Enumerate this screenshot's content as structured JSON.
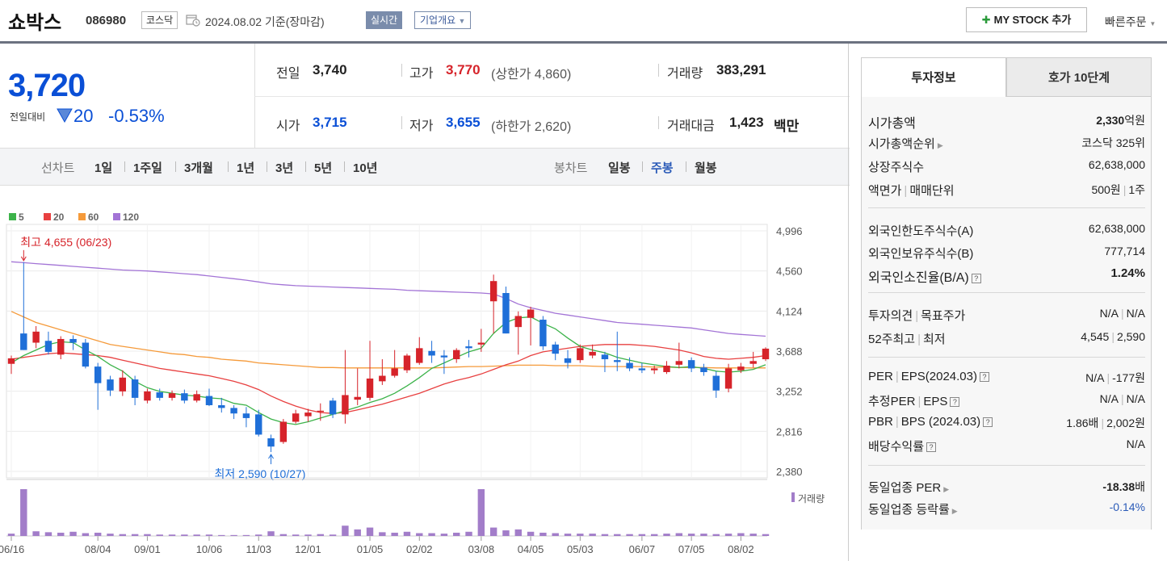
{
  "header": {
    "stock_name": "쇼박스",
    "stock_code": "086980",
    "market": "코스닥",
    "base_date": "2024.08.02 기준(장마감)",
    "realtime_label": "실시간",
    "overview_label": "기업개요",
    "mystock_label": "MY STOCK 추가",
    "quick_order_label": "빠른주문"
  },
  "price": {
    "current": "3,720",
    "prev_compare_label": "전일대비",
    "change": "20",
    "change_pct": "-0.53%",
    "prev_close_label": "전일",
    "prev_close": "3,740",
    "high_label": "고가",
    "high": "3,770",
    "upper_limit": "(상한가 4,860)",
    "volume_label": "거래량",
    "volume": "383,291",
    "open_label": "시가",
    "open": "3,715",
    "low_label": "저가",
    "low": "3,655",
    "lower_limit": "(하한가 2,620)",
    "amount_label": "거래대금",
    "amount": "1,423",
    "amount_unit": "백만"
  },
  "period_bar": {
    "line_chart_label": "선차트",
    "line_periods": [
      "1일",
      "1주일",
      "3개월",
      "1년",
      "3년",
      "5년",
      "10년"
    ],
    "candle_chart_label": "봉차트",
    "candle_periods": [
      "일봉",
      "주봉",
      "월봉"
    ],
    "candle_selected": "주봉"
  },
  "chart_data": {
    "type": "candlestick",
    "legend": [
      {
        "name": "5",
        "color": "#3cb34a"
      },
      {
        "name": "20",
        "color": "#e84040"
      },
      {
        "name": "60",
        "color": "#f59a3a"
      },
      {
        "name": "120",
        "color": "#a374d6"
      }
    ],
    "y_ticks": [
      "4,996",
      "4,560",
      "4,124",
      "3,688",
      "3,252",
      "2,816",
      "2,380"
    ],
    "ylim": [
      2380,
      4996
    ],
    "x_ticks": [
      "06/16",
      "08/04",
      "09/01",
      "10/06",
      "11/03",
      "12/01",
      "01/05",
      "02/02",
      "03/08",
      "04/05",
      "05/03",
      "06/07",
      "07/05",
      "08/02"
    ],
    "x_tick_index": [
      0,
      7,
      11,
      16,
      20,
      24,
      29,
      33,
      38,
      42,
      46,
      51,
      55,
      59
    ],
    "high_annotation": "최고 4,655 (06/23)",
    "low_annotation": "최저 2,590 (10/27)",
    "volume_label": "거래량",
    "candles": [
      {
        "o": 3550,
        "h": 3640,
        "l": 3440,
        "c": 3610
      },
      {
        "o": 3880,
        "h": 4655,
        "l": 3700,
        "c": 3700
      },
      {
        "o": 3780,
        "h": 3960,
        "l": 3720,
        "c": 3900
      },
      {
        "o": 3800,
        "h": 3900,
        "l": 3650,
        "c": 3680
      },
      {
        "o": 3650,
        "h": 3850,
        "l": 3600,
        "c": 3820
      },
      {
        "o": 3820,
        "h": 3860,
        "l": 3700,
        "c": 3780
      },
      {
        "o": 3780,
        "h": 3820,
        "l": 3500,
        "c": 3520
      },
      {
        "o": 3520,
        "h": 3560,
        "l": 3050,
        "c": 3340
      },
      {
        "o": 3380,
        "h": 3420,
        "l": 3200,
        "c": 3260
      },
      {
        "o": 3250,
        "h": 3480,
        "l": 3200,
        "c": 3400
      },
      {
        "o": 3380,
        "h": 3420,
        "l": 3100,
        "c": 3180
      },
      {
        "o": 3150,
        "h": 3280,
        "l": 3120,
        "c": 3250
      },
      {
        "o": 3240,
        "h": 3280,
        "l": 3150,
        "c": 3180
      },
      {
        "o": 3180,
        "h": 3260,
        "l": 3150,
        "c": 3230
      },
      {
        "o": 3230,
        "h": 3270,
        "l": 3120,
        "c": 3150
      },
      {
        "o": 3150,
        "h": 3260,
        "l": 3130,
        "c": 3220
      },
      {
        "o": 3200,
        "h": 3280,
        "l": 3090,
        "c": 3100
      },
      {
        "o": 3100,
        "h": 3180,
        "l": 3020,
        "c": 3070
      },
      {
        "o": 3070,
        "h": 3100,
        "l": 2950,
        "c": 3010
      },
      {
        "o": 3010,
        "h": 3080,
        "l": 2860,
        "c": 2960
      },
      {
        "o": 3000,
        "h": 3050,
        "l": 2760,
        "c": 2780
      },
      {
        "o": 2740,
        "h": 2780,
        "l": 2590,
        "c": 2650
      },
      {
        "o": 2700,
        "h": 2950,
        "l": 2680,
        "c": 2920
      },
      {
        "o": 2920,
        "h": 3050,
        "l": 2900,
        "c": 3010
      },
      {
        "o": 2980,
        "h": 3060,
        "l": 2920,
        "c": 3020
      },
      {
        "o": 3030,
        "h": 3120,
        "l": 2930,
        "c": 3040
      },
      {
        "o": 3150,
        "h": 3180,
        "l": 2960,
        "c": 3000
      },
      {
        "o": 3000,
        "h": 3700,
        "l": 2900,
        "c": 3210
      },
      {
        "o": 3160,
        "h": 3500,
        "l": 3100,
        "c": 3190
      },
      {
        "o": 3180,
        "h": 3800,
        "l": 3150,
        "c": 3390
      },
      {
        "o": 3360,
        "h": 3600,
        "l": 3320,
        "c": 3420
      },
      {
        "o": 3420,
        "h": 3700,
        "l": 3400,
        "c": 3500
      },
      {
        "o": 3480,
        "h": 3660,
        "l": 3450,
        "c": 3640
      },
      {
        "o": 3560,
        "h": 3840,
        "l": 3540,
        "c": 3720
      },
      {
        "o": 3690,
        "h": 3800,
        "l": 3560,
        "c": 3640
      },
      {
        "o": 3640,
        "h": 3700,
        "l": 3440,
        "c": 3620
      },
      {
        "o": 3600,
        "h": 3720,
        "l": 3560,
        "c": 3700
      },
      {
        "o": 3740,
        "h": 3810,
        "l": 3620,
        "c": 3720
      },
      {
        "o": 3760,
        "h": 3930,
        "l": 3680,
        "c": 3780
      },
      {
        "o": 4230,
        "h": 4520,
        "l": 3880,
        "c": 4450
      },
      {
        "o": 4320,
        "h": 4390,
        "l": 3880,
        "c": 3880
      },
      {
        "o": 3950,
        "h": 4120,
        "l": 3650,
        "c": 4070
      },
      {
        "o": 4050,
        "h": 4170,
        "l": 3750,
        "c": 4140
      },
      {
        "o": 4030,
        "h": 4070,
        "l": 3700,
        "c": 3740
      },
      {
        "o": 3760,
        "h": 3790,
        "l": 3590,
        "c": 3660
      },
      {
        "o": 3610,
        "h": 3700,
        "l": 3500,
        "c": 3560
      },
      {
        "o": 3590,
        "h": 3760,
        "l": 3560,
        "c": 3720
      },
      {
        "o": 3640,
        "h": 3760,
        "l": 3610,
        "c": 3680
      },
      {
        "o": 3650,
        "h": 3680,
        "l": 3460,
        "c": 3600
      },
      {
        "o": 3590,
        "h": 3900,
        "l": 3470,
        "c": 3570
      },
      {
        "o": 3560,
        "h": 3620,
        "l": 3470,
        "c": 3500
      },
      {
        "o": 3500,
        "h": 3560,
        "l": 3450,
        "c": 3480
      },
      {
        "o": 3480,
        "h": 3530,
        "l": 3440,
        "c": 3500
      },
      {
        "o": 3460,
        "h": 3580,
        "l": 3440,
        "c": 3530
      },
      {
        "o": 3540,
        "h": 3780,
        "l": 3500,
        "c": 3580
      },
      {
        "o": 3590,
        "h": 3620,
        "l": 3460,
        "c": 3500
      },
      {
        "o": 3510,
        "h": 3550,
        "l": 3420,
        "c": 3460
      },
      {
        "o": 3420,
        "h": 3470,
        "l": 3180,
        "c": 3260
      },
      {
        "o": 3280,
        "h": 3550,
        "l": 3240,
        "c": 3500
      },
      {
        "o": 3480,
        "h": 3560,
        "l": 3450,
        "c": 3520
      },
      {
        "o": 3550,
        "h": 3680,
        "l": 3510,
        "c": 3580
      },
      {
        "o": 3600,
        "h": 3730,
        "l": 3580,
        "c": 3715
      }
    ],
    "volumes": [
      5,
      100,
      10,
      8,
      7,
      9,
      6,
      7,
      5,
      4,
      4,
      4,
      3,
      3,
      3,
      3,
      3,
      2,
      2,
      2,
      3,
      10,
      4,
      3,
      3,
      4,
      3,
      22,
      14,
      18,
      8,
      7,
      9,
      6,
      6,
      5,
      7,
      9,
      100,
      18,
      12,
      14,
      9,
      7,
      6,
      5,
      5,
      5,
      4,
      4,
      4,
      4,
      4,
      5,
      6,
      5,
      5,
      4,
      5,
      6,
      5,
      4
    ],
    "ma5": [
      3560,
      3640,
      3700,
      3760,
      3790,
      3780,
      3700,
      3630,
      3540,
      3470,
      3360,
      3290,
      3250,
      3230,
      3210,
      3200,
      3180,
      3170,
      3120,
      3100,
      3020,
      2950,
      2910,
      2890,
      2920,
      2960,
      3000,
      3040,
      3080,
      3130,
      3170,
      3230,
      3310,
      3400,
      3500,
      3560,
      3620,
      3680,
      3720,
      3880,
      4000,
      4050,
      4060,
      3990,
      3930,
      3830,
      3740,
      3700,
      3670,
      3620,
      3590,
      3560,
      3540,
      3520,
      3510,
      3520,
      3500,
      3470,
      3460,
      3470,
      3490,
      3540
    ],
    "ma20": [
      3600,
      3620,
      3640,
      3660,
      3670,
      3660,
      3650,
      3640,
      3620,
      3590,
      3560,
      3530,
      3500,
      3480,
      3460,
      3440,
      3420,
      3390,
      3360,
      3320,
      3270,
      3200,
      3140,
      3090,
      3050,
      3020,
      3010,
      3020,
      3050,
      3080,
      3110,
      3150,
      3190,
      3230,
      3280,
      3330,
      3370,
      3400,
      3440,
      3490,
      3540,
      3580,
      3640,
      3680,
      3700,
      3720,
      3740,
      3750,
      3760,
      3760,
      3760,
      3750,
      3740,
      3720,
      3700,
      3670,
      3630,
      3610,
      3600,
      3610,
      3620,
      3640
    ],
    "ma60": [
      4120,
      4060,
      4000,
      3960,
      3920,
      3880,
      3840,
      3800,
      3760,
      3740,
      3720,
      3700,
      3680,
      3660,
      3650,
      3630,
      3620,
      3600,
      3590,
      3580,
      3560,
      3550,
      3540,
      3530,
      3520,
      3510,
      3510,
      3505,
      3505,
      3505,
      3505,
      3505,
      3505,
      3505,
      3505,
      3510,
      3515,
      3520,
      3520,
      3525,
      3530,
      3535,
      3535,
      3535,
      3530,
      3530,
      3530,
      3525,
      3520,
      3520,
      3520,
      3520,
      3515,
      3515,
      3510,
      3510,
      3510,
      3505,
      3505,
      3505,
      3505,
      3505
    ],
    "ma120": [
      4660,
      4650,
      4640,
      4630,
      4620,
      4610,
      4600,
      4590,
      4580,
      4570,
      4565,
      4560,
      4550,
      4540,
      4530,
      4520,
      4505,
      4490,
      4475,
      4460,
      4440,
      4420,
      4410,
      4400,
      4395,
      4390,
      4385,
      4380,
      4375,
      4370,
      4365,
      4360,
      4350,
      4345,
      4340,
      4335,
      4330,
      4325,
      4320,
      4310,
      4260,
      4200,
      4160,
      4130,
      4100,
      4080,
      4060,
      4040,
      4020,
      4000,
      3990,
      3980,
      3970,
      3960,
      3950,
      3940,
      3920,
      3900,
      3880,
      3870,
      3860,
      3850
    ]
  },
  "side": {
    "tab_invest": "투자정보",
    "tab_order": "호가 10단계",
    "market_cap_label": "시가총액",
    "market_cap_num": "2,330",
    "market_cap_unit": "억원",
    "market_cap_rank_label": "시가총액순위",
    "market_cap_rank": "코스닥 325위",
    "shares_label": "상장주식수",
    "shares": "62,638,000",
    "face_label_a": "액면가",
    "face_label_b": "매매단위",
    "face_val": "500원",
    "unit_val": "1주",
    "foreign_limit_label": "외국인한도주식수(A)",
    "foreign_limit": "62,638,000",
    "foreign_hold_label": "외국인보유주식수(B)",
    "foreign_hold": "777,714",
    "foreign_ratio_label": "외국인소진율(B/A)",
    "foreign_ratio": "1.24%",
    "opinion_label_a": "투자의견",
    "opinion_label_b": "목표주가",
    "opinion_val": "N/A",
    "target_val": "N/A",
    "wk52_label_a": "52주최고",
    "wk52_label_b": "최저",
    "wk52_high": "4,545",
    "wk52_low": "2,590",
    "per_label_a": "PER",
    "per_label_b": "EPS(2024.03)",
    "per_val": "N/A",
    "eps_val": "-177원",
    "est_per_label_a": "추정PER",
    "est_per_label_b": "EPS",
    "est_per_val": "N/A",
    "est_eps_val": "N/A",
    "pbr_label_a": "PBR",
    "pbr_label_b": "BPS (2024.03)",
    "pbr_val": "1.86배",
    "bps_val": "2,002원",
    "div_label": "배당수익률",
    "div_val": "N/A",
    "ind_per_label": "동일업종 PER",
    "ind_per_num": "-18.38",
    "ind_per_unit": "배",
    "ind_rate_label": "동일업종 등락률",
    "ind_rate": "-0.14%"
  }
}
